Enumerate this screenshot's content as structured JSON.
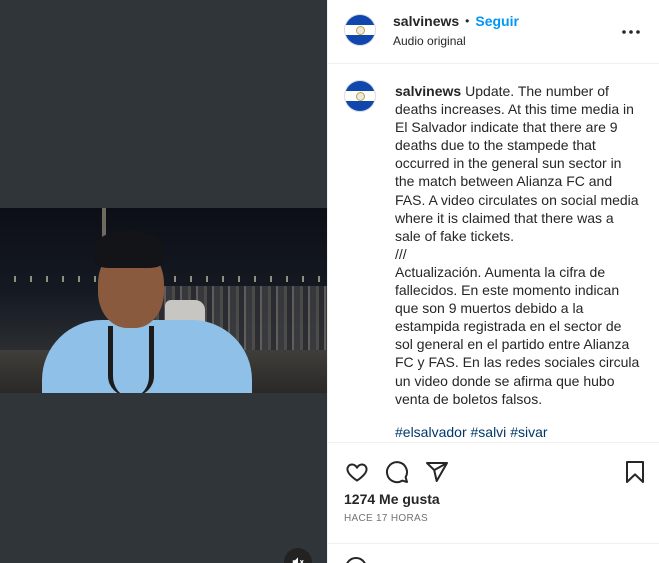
{
  "post": {
    "username": "salvinews",
    "separator": "•",
    "follow_label": "Seguir",
    "audio_label": "Audio original",
    "caption": "Update. The number of deaths increases. At this time media in El Salvador indicate that there are 9 deaths due to the stampede that occurred in the general sun sector in the match between Alianza FC and FAS. A video circulates on social media where it is claimed that there was a sale of fake tickets.\n///\nActualización. Aumenta la cifra de fallecidos. En este momento indican que son 9 muertos debido a la estampida registrada en el sector de sol general en el partido entre Alianza FC y FAS. En las redes sociales circula un video donde se afirma que hubo venta de boletos falsos.",
    "hashtags": [
      "#elsalvador",
      "#salvi",
      "#sivar"
    ],
    "likes": "1274 Me gusta",
    "time_ago": "HACE 17 HORAS"
  },
  "icons": {
    "more": "more-options-icon",
    "like": "heart-icon",
    "comment": "comment-icon",
    "share": "send-icon",
    "save": "bookmark-icon",
    "mute": "muted-speaker-icon",
    "emoji": "emoji-icon"
  },
  "colors": {
    "accent": "#0095f6",
    "hashtag": "#00376b",
    "flag_blue": "#0f47af",
    "media_background": "#30353a"
  }
}
